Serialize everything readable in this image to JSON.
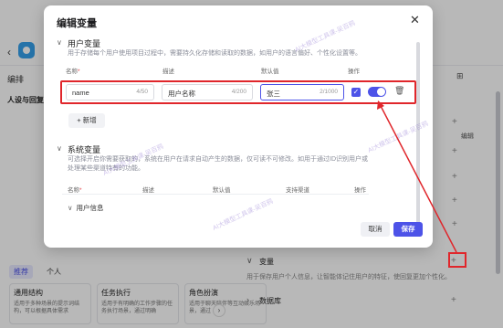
{
  "background": {
    "section_title": "编排",
    "subtitle": "人设与回复",
    "dots_icon": "grid-icon",
    "right_text": "编辑",
    "tabs": [
      {
        "label": "推荐",
        "active": true
      },
      {
        "label": "个人",
        "active": false
      }
    ],
    "cards": [
      {
        "title": "通用结构",
        "desc": "适用于多种场景的提示词结构，可以根据具体需求"
      },
      {
        "title": "任务执行",
        "desc": "适用于有明确的工作步骤的任务执行场景，通过明确"
      },
      {
        "title": "角色扮演",
        "desc": "适用于聊天陪伴等互动娱乐场景，通过"
      }
    ],
    "variable_label": "变量",
    "variable_desc": "用于保存用户个人信息，让智能体记住用户的特征，使回复更加个性化。",
    "database_label": "数据库"
  },
  "modal": {
    "title": "编辑变量",
    "user_section": {
      "title": "用户变量",
      "desc": "用于存储每个用户使用项目过程中，需要持久化存储和读取的数据，如用户的语言偏好、个性化设置等。",
      "columns": {
        "name": "名称",
        "desc": "描述",
        "default": "默认值",
        "action": "操作"
      },
      "row": {
        "name": "name",
        "name_count": "4/50",
        "desc": "用户名称",
        "desc_count": "4/200",
        "default": "张三",
        "default_count": "2/1000"
      },
      "add_label": "+ 新增"
    },
    "system_section": {
      "title": "系统变量",
      "desc": "可选择开启你需要获取的，系统在用户在请求自动产生的数据，仅可读不可修改。如用于通过ID识别用户或处理某些渠道特有的功能。",
      "columns": {
        "name": "名称",
        "desc": "描述",
        "default": "默认值",
        "source": "支持渠道",
        "action": "操作"
      },
      "group": "用户信息"
    },
    "cancel_label": "取消",
    "save_label": "保存"
  },
  "watermark": "AI大模型工具课-吴百鸦",
  "colors": {
    "accent": "#4d53e8",
    "highlight": "#e0262b"
  }
}
